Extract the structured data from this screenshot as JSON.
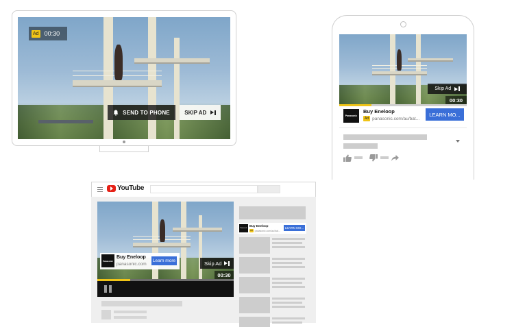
{
  "tv": {
    "ad_badge": "Ad",
    "timer": "00:30",
    "send_to_phone": "SEND TO PHONE",
    "skip": "SKIP AD"
  },
  "phone": {
    "skip": "Skip Ad",
    "timer": "00:30",
    "brand_logo": "Panasonic",
    "title": "Buy Eneloop",
    "ad_badge": "Ad",
    "url": "panasonic.com/au/bat...",
    "cta": "LEARN MO...",
    "progress": 0.25
  },
  "desktop": {
    "site_logo": "YouTube",
    "brand_logo": "Panasonic",
    "title": "Buy Eneloop",
    "url": "panasonic.com",
    "cta": "Learn more",
    "skip": "Skip Ad",
    "timer": "00:30",
    "progress": 0.24,
    "side_ad": {
      "brand_logo": "Panasonic",
      "title": "Buy Eneloop",
      "ad_badge": "Ad",
      "url": "panasonic.com/au/bat...",
      "cta": "LEARN MO..."
    }
  },
  "colors": {
    "accent_blue": "#3a6fd8",
    "ad_yellow": "#f0c417",
    "youtube_red": "#e62117"
  }
}
